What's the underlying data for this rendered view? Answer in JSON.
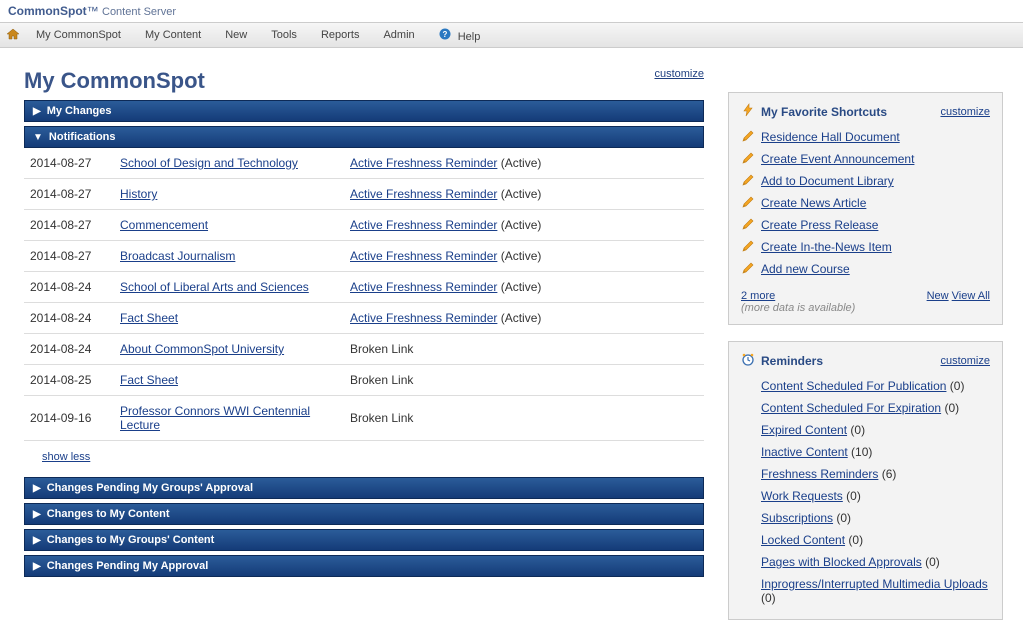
{
  "brand": {
    "name": "CommonSpot",
    "suffix": "Content Server"
  },
  "menu": {
    "home_icon": "home",
    "items": [
      "My CommonSpot",
      "My Content",
      "New",
      "Tools",
      "Reports",
      "Admin"
    ],
    "help_label": "Help"
  },
  "page": {
    "title": "My CommonSpot",
    "customize": "customize"
  },
  "sections": {
    "my_changes": "My Changes",
    "notifications": "Notifications",
    "changes_pending_groups_approval": "Changes Pending My Groups' Approval",
    "changes_to_my_content": "Changes to My Content",
    "changes_to_groups_content": "Changes to My Groups' Content",
    "changes_pending_my_approval": "Changes Pending My Approval"
  },
  "notifications": [
    {
      "date": "2014-08-27",
      "page": "School of Design and Technology",
      "type_link": "Active Freshness Reminder",
      "suffix": "(Active)"
    },
    {
      "date": "2014-08-27",
      "page": "History",
      "type_link": "Active Freshness Reminder",
      "suffix": "(Active)"
    },
    {
      "date": "2014-08-27",
      "page": "Commencement",
      "type_link": "Active Freshness Reminder",
      "suffix": "(Active)"
    },
    {
      "date": "2014-08-27",
      "page": "Broadcast Journalism",
      "type_link": "Active Freshness Reminder",
      "suffix": "(Active)"
    },
    {
      "date": "2014-08-24",
      "page": "School of Liberal Arts and Sciences",
      "type_link": "Active Freshness Reminder",
      "suffix": "(Active)"
    },
    {
      "date": "2014-08-24",
      "page": "Fact Sheet",
      "type_link": "Active Freshness Reminder",
      "suffix": "(Active)"
    },
    {
      "date": "2014-08-24",
      "page": "About CommonSpot University",
      "type_text": "Broken Link"
    },
    {
      "date": "2014-08-25",
      "page": "Fact Sheet",
      "type_text": "Broken Link"
    },
    {
      "date": "2014-09-16",
      "page": "Professor Connors WWI Centennial Lecture",
      "type_text": "Broken Link"
    }
  ],
  "show_less": "show less",
  "shortcuts": {
    "title": "My Favorite Shortcuts",
    "customize": "customize",
    "items": [
      "Residence Hall Document",
      "Create Event Announcement",
      "Add to Document Library",
      "Create News Article",
      "Create Press Release",
      "Create In-the-News Item",
      "Add new Course"
    ],
    "more_link": "2 more",
    "more_note": "(more data is available)",
    "new_link": "New",
    "viewall_link": "View All"
  },
  "reminders": {
    "title": "Reminders",
    "customize": "customize",
    "items": [
      {
        "label": "Content Scheduled For Publication",
        "count": 0
      },
      {
        "label": "Content Scheduled For Expiration",
        "count": 0
      },
      {
        "label": "Expired Content",
        "count": 0
      },
      {
        "label": "Inactive Content",
        "count": 10
      },
      {
        "label": "Freshness Reminders",
        "count": 6
      },
      {
        "label": "Work Requests",
        "count": 0
      },
      {
        "label": "Subscriptions",
        "count": 0
      },
      {
        "label": "Locked Content",
        "count": 0
      },
      {
        "label": "Pages with Blocked Approvals",
        "count": 0
      },
      {
        "label": "Inprogress/Interrupted Multimedia Uploads",
        "count": 0
      }
    ]
  }
}
